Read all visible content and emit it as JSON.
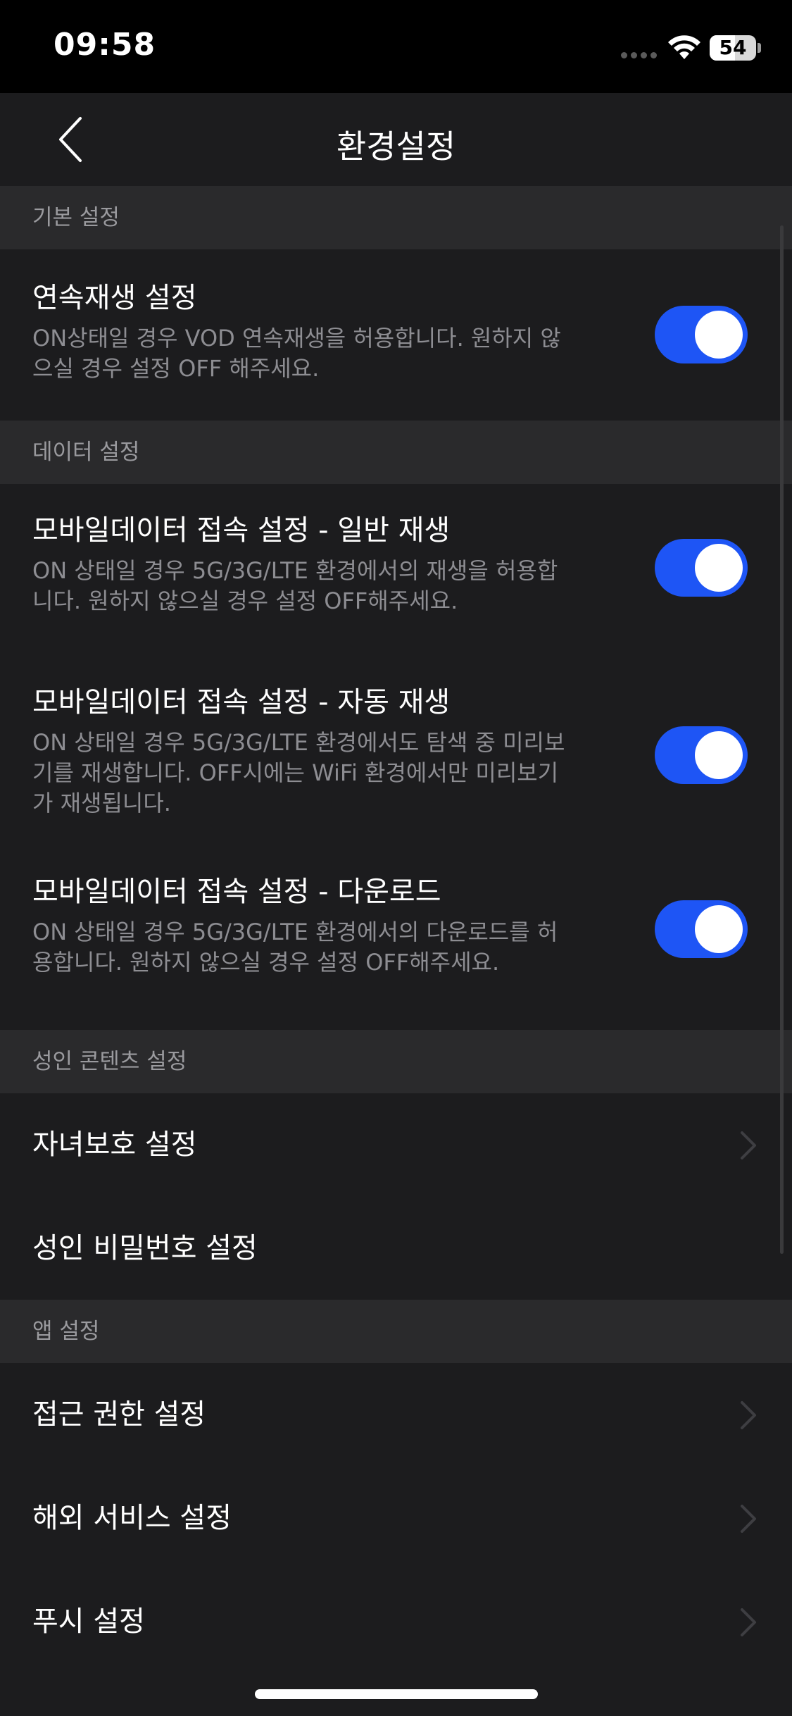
{
  "status_bar": {
    "time": "09:58",
    "battery": "54",
    "icons": [
      "signal-dots-icon",
      "wifi-icon",
      "battery-icon"
    ]
  },
  "nav": {
    "title": "환경설정",
    "back_icon": "chevron-left-icon"
  },
  "sections": [
    {
      "header": "기본 설정",
      "items": [
        {
          "title": "연속재생 설정",
          "description": "ON상태일 경우 VOD 연속재생을 허용합니다. 원하지 않으실 경우 설정 OFF 해주세요.",
          "toggle": "on"
        }
      ]
    },
    {
      "header": "데이터 설정",
      "items": [
        {
          "title": "모바일데이터 접속 설정 - 일반 재생",
          "description": "ON 상태일 경우 5G/3G/LTE 환경에서의 재생을 허용합니다. 원하지 않으실 경우 설정 OFF해주세요.",
          "toggle": "on"
        },
        {
          "title": "모바일데이터 접속 설정 - 자동 재생",
          "description": "ON 상태일 경우 5G/3G/LTE 환경에서도 탐색 중 미리보기를 재생합니다. OFF시에는 WiFi 환경에서만 미리보기가 재생됩니다.",
          "toggle": "on"
        },
        {
          "title": "모바일데이터 접속 설정 - 다운로드",
          "description": "ON 상태일 경우 5G/3G/LTE 환경에서의 다운로드를 허용합니다. 원하지 않으실 경우 설정 OFF해주세요.",
          "toggle": "on"
        }
      ]
    },
    {
      "header": "성인 콘텐츠 설정",
      "items": [
        {
          "title": "자녀보호 설정",
          "chevron": true
        },
        {
          "title": "성인 비밀번호 설정",
          "chevron": false
        }
      ]
    },
    {
      "header": "앱 설정",
      "items": [
        {
          "title": "접근 권한 설정",
          "chevron": true
        },
        {
          "title": "해외 서비스 설정",
          "chevron": true
        },
        {
          "title": "푸시 설정",
          "chevron": true
        }
      ]
    }
  ],
  "colors": {
    "toggle_on": "#1e55f5",
    "background": "#1c1c1e",
    "section_header_bg": "#2a2a2c"
  }
}
